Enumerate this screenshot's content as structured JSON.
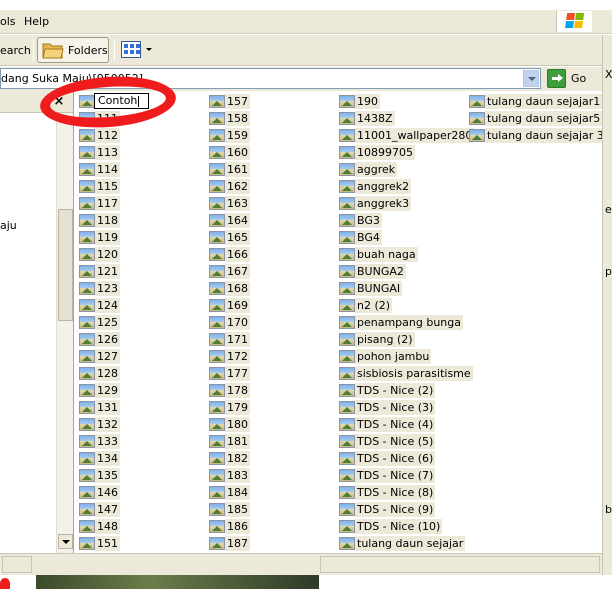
{
  "menu": {
    "tools_partial": "ols",
    "help": "Help"
  },
  "toolbar": {
    "search_partial": "earch",
    "folders": "Folders"
  },
  "address": {
    "path_partial": "dang Suka Maju\\[050052]",
    "go": "Go"
  },
  "left_pane": {
    "close": "×",
    "text_partial": "aju"
  },
  "rename_text": "Contoh",
  "files": {
    "col1": [
      "111",
      "112",
      "113",
      "114",
      "115",
      "117",
      "118",
      "119",
      "120",
      "121",
      "123",
      "124",
      "125",
      "126",
      "127",
      "128",
      "129",
      "131",
      "132",
      "133",
      "134",
      "135",
      "146",
      "147",
      "148",
      "151"
    ],
    "col2": [
      "157",
      "158",
      "159",
      "160",
      "161",
      "162",
      "163",
      "164",
      "165",
      "166",
      "167",
      "168",
      "169",
      "170",
      "171",
      "172",
      "177",
      "178",
      "179",
      "180",
      "181",
      "182",
      "183",
      "184",
      "185",
      "186",
      "187"
    ],
    "col3": [
      "190",
      "1438Z",
      "11001_wallpaper280",
      "10899705",
      "aggrek",
      "anggrek2",
      "anggrek3",
      "BG3",
      "BG4",
      "buah naga",
      "BUNGA2",
      "BUNGAI",
      "n2 (2)",
      "penampang bunga",
      "pisang (2)",
      "pohon jambu",
      "sisbiosis parasitisme",
      "TDS - Nice (2)",
      "TDS - Nice (3)",
      "TDS - Nice (4)",
      "TDS - Nice (5)",
      "TDS - Nice (6)",
      "TDS - Nice (7)",
      "TDS - Nice (8)",
      "TDS - Nice (9)",
      "TDS - Nice (10)",
      "tulang daun sejajar"
    ],
    "col4": [
      "tulang daun sejajar1",
      "tulang daun sejajar5",
      "tulang daun sejajar 3"
    ]
  },
  "right_fragments": [
    "X",
    "e",
    "p",
    "b"
  ],
  "icons": {
    "file": "image-file-icon",
    "folders": "folder-icon",
    "views": "views-icon",
    "go": "go-arrow-icon",
    "logo": "windows-logo-icon"
  },
  "colors": {
    "chrome": "#ece9d8",
    "annotation_red": "#ee1c1c",
    "go_green": "#3d9e3b"
  }
}
